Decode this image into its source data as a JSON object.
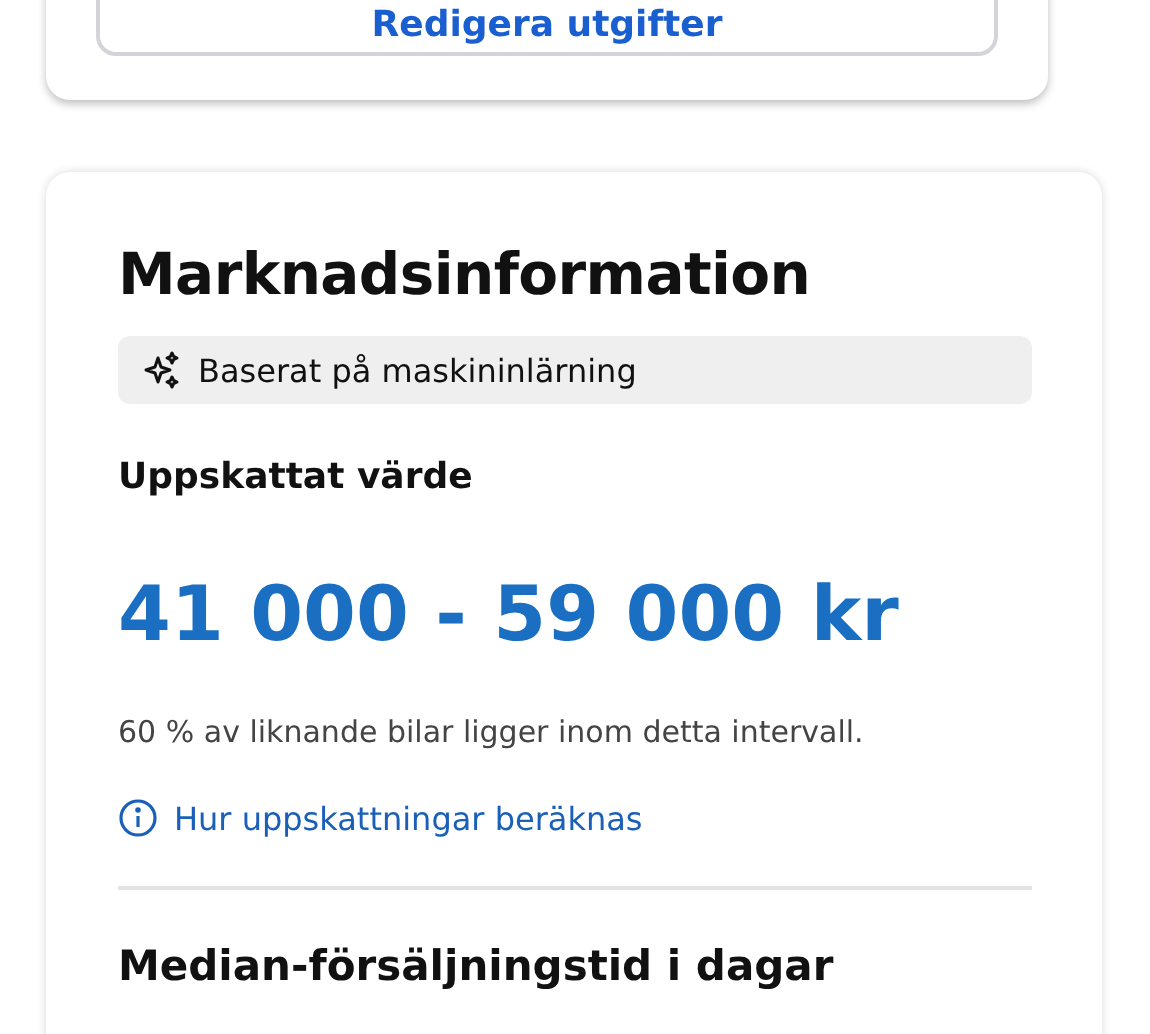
{
  "expenses_card": {
    "button": "Redigera utgifter"
  },
  "market_card": {
    "title": "Marknadsinformation",
    "badge": "Baserat på maskininlärning",
    "estimate_label": "Uppskattat värde",
    "estimate_value": "41 000 - 59 000 kr",
    "note": "60 % av liknande bilar ligger inom detta intervall.",
    "link": "Hur uppskattningar beräknas",
    "next_heading": "Median-försäljningstid i dagar"
  }
}
